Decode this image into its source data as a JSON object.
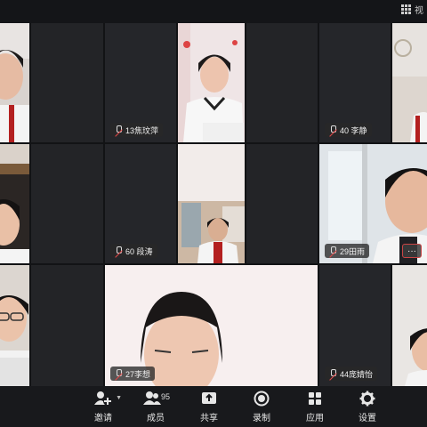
{
  "topbar": {
    "view_label": "视"
  },
  "tiles": {
    "t13": {
      "name": "13焦玟萍"
    },
    "t40": {
      "name": "40 李静"
    },
    "t60": {
      "name": "60  段涛"
    },
    "t29": {
      "name": "29田雨"
    },
    "t27": {
      "name": "27李想"
    },
    "t44": {
      "name": "44庞婧怡"
    }
  },
  "more_button": "···",
  "toolbar": {
    "invite": "邀请",
    "members": "成员",
    "member_count": "95",
    "share": "共享",
    "record": "录制",
    "apps": "应用",
    "settings": "设置"
  },
  "colors": {
    "background": "#121315",
    "toolbar": "#18191c",
    "tile_empty": "#232427",
    "muted_mic": "#e24848"
  }
}
